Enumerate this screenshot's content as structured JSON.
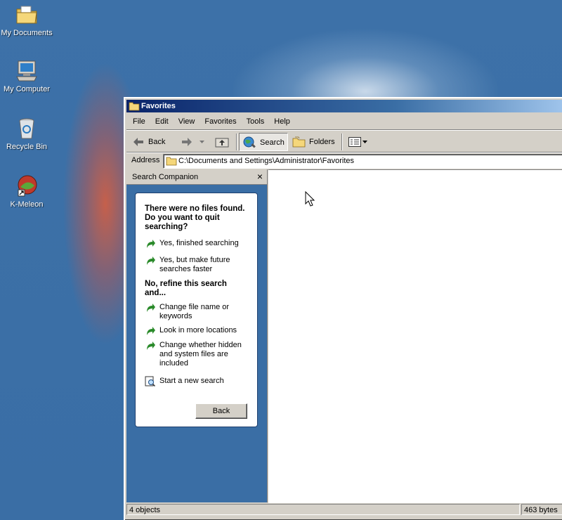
{
  "desktop": {
    "icons": [
      {
        "label": "My Documents",
        "icon": "folder-documents-icon"
      },
      {
        "label": "My Computer",
        "icon": "computer-icon"
      },
      {
        "label": "Recycle Bin",
        "icon": "recycle-bin-icon"
      },
      {
        "label": "K-Meleon",
        "icon": "kmeleon-browser-icon"
      }
    ]
  },
  "window": {
    "title": "Favorites",
    "menu": [
      "File",
      "Edit",
      "View",
      "Favorites",
      "Tools",
      "Help"
    ],
    "toolbar": {
      "back": "Back",
      "search": "Search",
      "folders": "Folders"
    },
    "address": {
      "label": "Address",
      "value": "C:\\Documents and Settings\\Administrator\\Favorites"
    },
    "search_companion": {
      "title": "Search Companion",
      "close": "×",
      "question": "There were no files found.  Do you want to quit searching?",
      "quit_options": [
        "Yes, finished searching",
        "Yes, but make future searches faster"
      ],
      "refine_heading": "No, refine this search and...",
      "refine_options": [
        "Change file name or keywords",
        "Look in more locations",
        "Change whether hidden and system files are included"
      ],
      "new_search": "Start a new search",
      "back_button": "Back"
    },
    "status": {
      "objects": "4 objects",
      "size": "463 bytes"
    }
  },
  "colors": {
    "desktop": "#3a6ea5",
    "titlebar_start": "#0a246a",
    "titlebar_end": "#a6caf0",
    "chrome": "#d4d0c8",
    "link_arrow": "#2a8a2a"
  }
}
